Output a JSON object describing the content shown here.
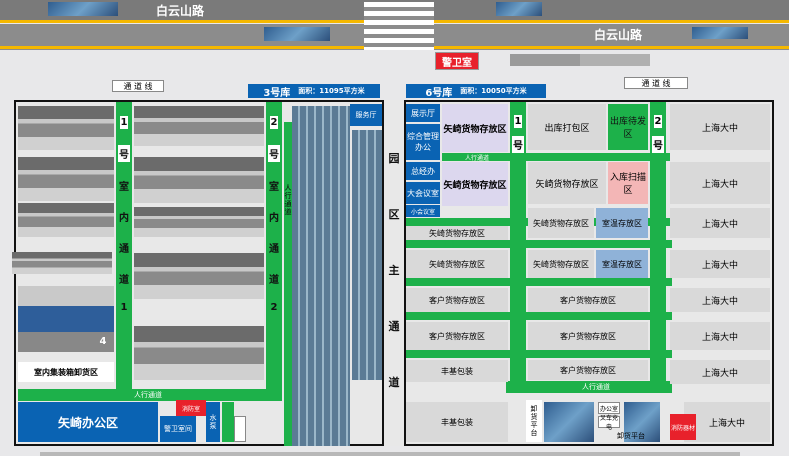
{
  "roads": {
    "top": "白云山路",
    "mid": "白云山路"
  },
  "gate": "警卫室",
  "side_labels": {
    "left": "通 道 线",
    "right": "通 道 线"
  },
  "warehouse3": {
    "title": "3号库",
    "area": "面积：11095平方米",
    "aisle1": [
      "1",
      "号",
      "室",
      "内",
      "通",
      "道",
      "1"
    ],
    "aisle2": [
      "2",
      "号",
      "室",
      "内",
      "通",
      "道",
      "2"
    ],
    "walkway": "人行通道",
    "walkway_lower": "人行通道",
    "service_hall": "服务厅",
    "zone4": "4",
    "indoor_area": "室内集装箱卸货区",
    "office": "矢崎办公区",
    "guard": "警卫室间",
    "fire": "消防室",
    "pump": "水泵",
    "vert_walk": "人行通道"
  },
  "center_road": [
    "园",
    "区",
    "主",
    "通",
    "道"
  ],
  "warehouse6": {
    "title": "6号库",
    "area": "面积：10050平方米",
    "left_rooms": [
      "展示厅",
      "综合管理办公",
      "总经办",
      "大会议室",
      "小会议室"
    ],
    "aisle1": [
      "1",
      "号"
    ],
    "aisle2": [
      "2",
      "号"
    ],
    "walkway_top": "人行通道",
    "walkway_bottom": "人行通道",
    "zones": {
      "r1": [
        "矢崎货物存放区",
        "出库打包区",
        "出库待发区",
        "上海大中"
      ],
      "r2": [
        "矢崎货物存放区",
        "矢崎货物存放区",
        "入库扫描区",
        "上海大中"
      ],
      "r3": [
        "矢崎货物存放区",
        "矢崎货物存放区",
        "室温存放区",
        "上海大中"
      ],
      "r4": [
        "矢崎货物存放区",
        "矢崎货物存放区",
        "室温存放区",
        "上海大中"
      ],
      "r5": [
        "客户货物存放区",
        "客户货物存放区",
        "上海大中"
      ],
      "r6": [
        "客户货物存放区",
        "客户货物存放区",
        "上海大中"
      ],
      "r7": [
        "丰基包装",
        "客户货物存放区",
        "上海大中"
      ],
      "r8": [
        "丰基包装",
        "上海大中"
      ]
    },
    "bottom_small": [
      "卸货平台",
      "卸货平台",
      "办公室",
      "叉车充电",
      "消防器材"
    ]
  },
  "colors": {
    "road": "#7a7a7a",
    "walkway": "#1db14a",
    "blue": "#0a63b3",
    "red": "#e8212b",
    "gray": "#d9d9d9",
    "lavender": "#dcd7ee",
    "pink": "#f3b6b6",
    "steel": "#8fb2d8"
  }
}
